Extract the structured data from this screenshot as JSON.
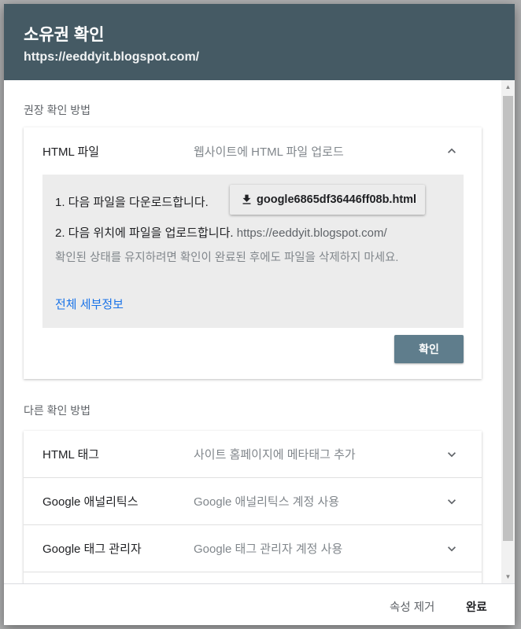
{
  "dialog": {
    "title": "소유권 확인",
    "subtitle": "https://eeddyit.blogspot.com/"
  },
  "recommended": {
    "section_label": "권장 확인 방법",
    "method": {
      "name": "HTML 파일",
      "description": "웹사이트에 HTML 파일 업로드",
      "chevron_icon": "chevron-up-icon",
      "step1_label": "1. 다음 파일을 다운로드합니다.",
      "download_icon": "download-icon",
      "download_file": "google6865df36446ff08b.html",
      "step2_label": "2. 다음 위치에 파일을 업로드합니다.",
      "step2_site": "https://eeddyit.blogspot.com/",
      "note": "확인된 상태를 유지하려면 확인이 완료된 후에도 파일을 삭제하지 마세요.",
      "details_link": "전체 세부정보",
      "verify_label": "확인"
    }
  },
  "other": {
    "section_label": "다른 확인 방법",
    "methods": [
      {
        "name": "HTML 태그",
        "description": "사이트 홈페이지에 메타태그 추가",
        "chevron_icon": "chevron-down-icon"
      },
      {
        "name": "Google 애널리틱스",
        "description": "Google 애널리틱스 계정 사용",
        "chevron_icon": "chevron-down-icon"
      },
      {
        "name": "Google 태그 관리자",
        "description": "Google 태그 관리자 계정 사용",
        "chevron_icon": "chevron-down-icon"
      }
    ]
  },
  "footer": {
    "remove_label": "속성 제거",
    "done_label": "완료"
  },
  "colors": {
    "header_bg": "#455a64",
    "verify_button_bg": "#5f7d8c",
    "link": "#1a73e8"
  }
}
